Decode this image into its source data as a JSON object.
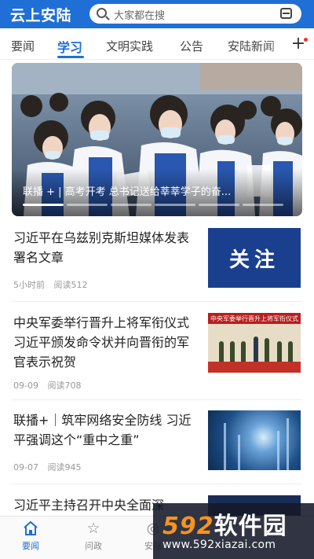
{
  "header": {
    "app_title": "云上安陆",
    "search_placeholder": "大家都在搜"
  },
  "tabs": [
    {
      "label": "要闻"
    },
    {
      "label": "学习"
    },
    {
      "label": "文明实践"
    },
    {
      "label": "公告"
    },
    {
      "label": "安陆新闻"
    }
  ],
  "tabs_active": "学习",
  "banner": {
    "caption": "联播 + | 高考开考 总书记送给莘莘学子的奋..."
  },
  "news": [
    {
      "title": "习近平在乌兹别克斯坦媒体发表署名文章",
      "time": "5小时前",
      "reads": "阅读512",
      "thumb_text": "关注"
    },
    {
      "title": "中央军委举行晋升上将军衔仪式 习近平颁发命令状并向晋衔的军官表示祝贺",
      "time": "09-09",
      "reads": "阅读708",
      "thumb_text": "中央军委举行晋升上将军衔仪式"
    },
    {
      "title": "联播+｜筑牢网络安全防线 习近平强调这个“重中之重”",
      "time": "09-07",
      "reads": "阅读945"
    },
    {
      "title": "习近平主持召开中央全面深"
    }
  ],
  "bottom_nav": [
    {
      "label": "要闻",
      "icon": "home-icon"
    },
    {
      "label": "问政",
      "icon": "star-icon"
    },
    {
      "label": "安陆",
      "icon": "location-icon"
    }
  ],
  "watermark": {
    "logo_num": "592",
    "logo_text": "软件园",
    "url": "www.592xiazai.com"
  },
  "colors": {
    "brand": "#1f6fd6",
    "watermark_orange": "#f7931e"
  }
}
